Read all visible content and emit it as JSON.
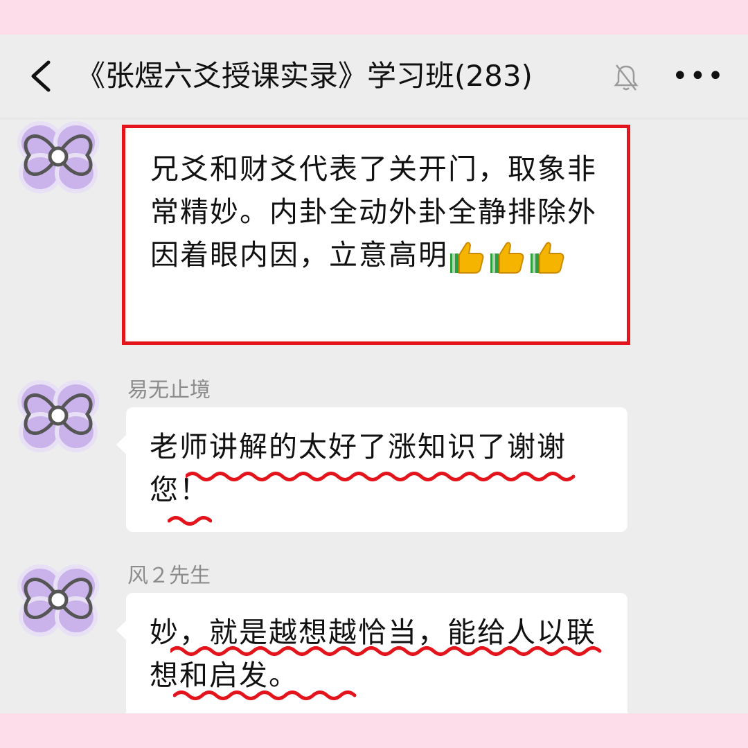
{
  "header": {
    "back_icon": "chevron-left-icon",
    "title": "《张煜六爻授课实录》学习班(283)",
    "mute_icon": "bell-muted-icon",
    "more_label": "•••"
  },
  "messages": [
    {
      "sender": "",
      "text": "兄爻和财爻代表了关开门，取象非常精妙。内卦全动外卦全静排除外因着眼内因，立意高明",
      "emoji": [
        "thumbs-up-icon",
        "thumbs-up-icon",
        "thumbs-up-icon"
      ],
      "highlighted": true
    },
    {
      "sender": "易无止境",
      "text": "老师讲解的太好了涨知识了谢谢您！",
      "underlined": true
    },
    {
      "sender": "风２先生",
      "text": "妙，就是越想越恰当，能给人以联想和启发。",
      "underlined": true
    }
  ],
  "colors": {
    "frame_pink": "#fddde9",
    "chat_bg": "#ededed",
    "highlight_red": "#e3141b",
    "squiggle_red": "#e3141b",
    "avatar_purple": "#c9b3ea"
  }
}
